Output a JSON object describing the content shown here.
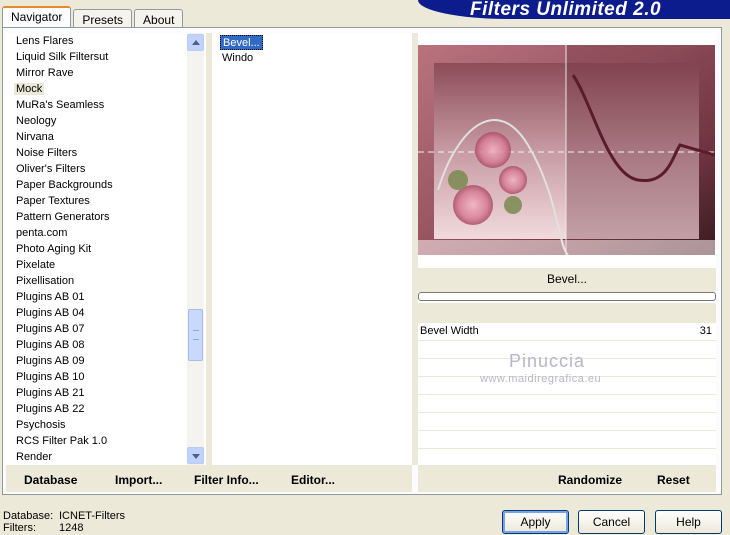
{
  "tabs": [
    {
      "label": "Navigator",
      "active": true
    },
    {
      "label": "Presets",
      "active": false
    },
    {
      "label": "About",
      "active": false
    }
  ],
  "banner_title": "Filters Unlimited 2.0",
  "category_list": [
    {
      "label": "Lens Flares",
      "selected": false
    },
    {
      "label": "Liquid Silk Filtersut",
      "selected": false
    },
    {
      "label": "Mirror Rave",
      "selected": false
    },
    {
      "label": "Mock",
      "selected": true
    },
    {
      "label": "MuRa's Seamless",
      "selected": false
    },
    {
      "label": "Neology",
      "selected": false
    },
    {
      "label": "Nirvana",
      "selected": false
    },
    {
      "label": "Noise Filters",
      "selected": false
    },
    {
      "label": "Oliver's Filters",
      "selected": false
    },
    {
      "label": "Paper Backgrounds",
      "selected": false
    },
    {
      "label": "Paper Textures",
      "selected": false
    },
    {
      "label": "Pattern Generators",
      "selected": false
    },
    {
      "label": "penta.com",
      "selected": false
    },
    {
      "label": "Photo Aging Kit",
      "selected": false
    },
    {
      "label": "Pixelate",
      "selected": false
    },
    {
      "label": "Pixellisation",
      "selected": false
    },
    {
      "label": "Plugins AB 01",
      "selected": false
    },
    {
      "label": "Plugins AB 04",
      "selected": false
    },
    {
      "label": "Plugins AB 07",
      "selected": false
    },
    {
      "label": "Plugins AB 08",
      "selected": false
    },
    {
      "label": "Plugins AB 09",
      "selected": false
    },
    {
      "label": "Plugins AB 10",
      "selected": false
    },
    {
      "label": "Plugins AB 21",
      "selected": false
    },
    {
      "label": "Plugins AB 22",
      "selected": false
    },
    {
      "label": "Psychosis",
      "selected": false
    },
    {
      "label": "RCS Filter Pak 1.0",
      "selected": false
    },
    {
      "label": "Render",
      "selected": false
    }
  ],
  "filter_list": [
    {
      "label": "Bevel...",
      "selected": true
    },
    {
      "label": "Windo",
      "selected": false
    }
  ],
  "preview": {
    "filter_name": "Bevel..."
  },
  "parameters": [
    {
      "label": "Bevel Width",
      "value": "31"
    }
  ],
  "watermark": {
    "name": "Pinuccia",
    "site": "www.maidiregrafica.eu"
  },
  "bottom_links": {
    "database": "Database",
    "import": "Import...",
    "filter_info": "Filter Info...",
    "editor": "Editor...",
    "randomize": "Randomize",
    "reset": "Reset"
  },
  "status": {
    "database_label": "Database:",
    "database_value": "ICNET-Filters",
    "filters_label": "Filters:",
    "filters_value": "1248"
  },
  "buttons": {
    "apply": "Apply",
    "cancel": "Cancel",
    "help": "Help"
  },
  "colors": {
    "selection": "#316ac5",
    "banner": "#0c1c8c",
    "tab_accent": "#e68b2c"
  }
}
